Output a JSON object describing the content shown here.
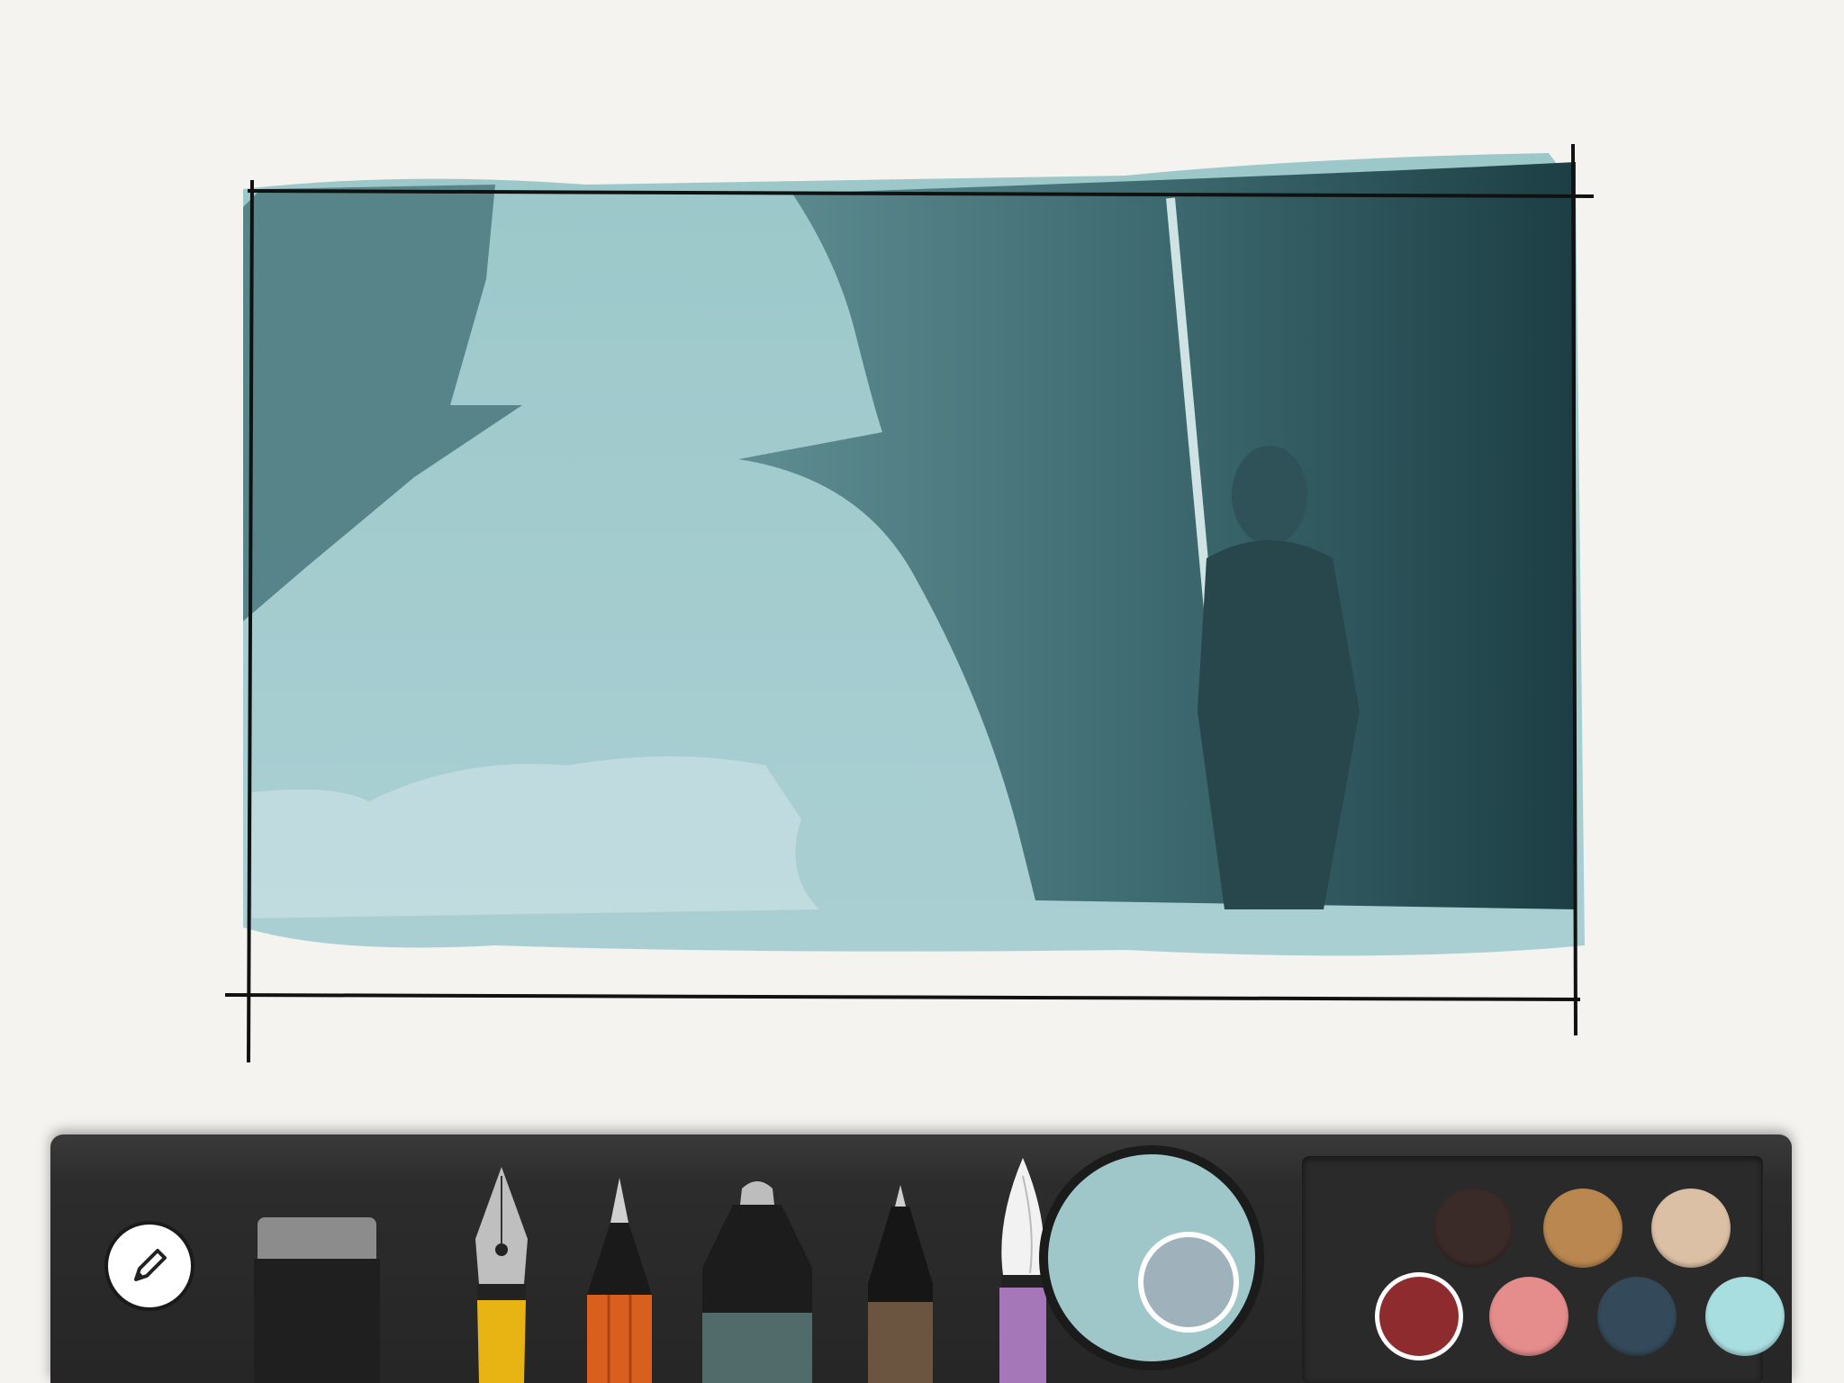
{
  "app": {
    "current_color": "#9fc6c9",
    "previous_color": "#9fb1ba"
  },
  "toolbar": {
    "context_icon": "pencil-icon",
    "tools": [
      {
        "id": "eraser",
        "icon": "eraser-icon",
        "color": "#2a2a2a"
      },
      {
        "id": "fountain-pen",
        "icon": "fountain-pen-icon",
        "color": "#e8b414"
      },
      {
        "id": "pencil",
        "icon": "pencil-tool-icon",
        "color": "#d85f1e"
      },
      {
        "id": "marker",
        "icon": "marker-icon",
        "color": "#516a6a"
      },
      {
        "id": "outline-pen",
        "icon": "outline-pen-icon",
        "color": "#6b5440"
      },
      {
        "id": "watercolor-brush",
        "icon": "watercolor-brush-icon",
        "color": "#a577b8"
      }
    ]
  },
  "palette": {
    "swatches": [
      {
        "color": "#3a2a28",
        "selected": false
      },
      {
        "color": "#b9874f",
        "selected": false
      },
      {
        "color": "#dcc0a6",
        "selected": false
      },
      {
        "color": "#8e2b2e",
        "selected": true
      },
      {
        "color": "#e58c8c",
        "selected": false
      },
      {
        "color": "#344a5a",
        "selected": false
      },
      {
        "color": "#a9dee0",
        "selected": false
      }
    ]
  }
}
